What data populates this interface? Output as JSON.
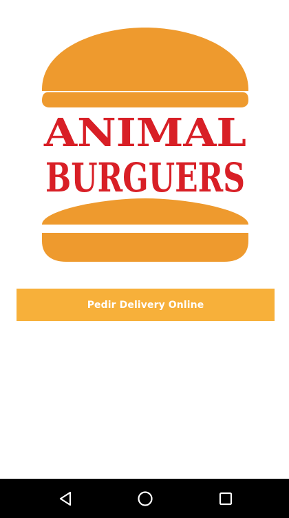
{
  "logo": {
    "line1": "ANIMAL",
    "line2": "BURGUERS",
    "bun_color": "#ee9a2e",
    "text_color": "#d81f26"
  },
  "cta": {
    "label": "Pedir Delivery Online",
    "background": "#f7b03a"
  },
  "navbar": {
    "back": "back-icon",
    "home": "home-icon",
    "recents": "recents-icon"
  }
}
